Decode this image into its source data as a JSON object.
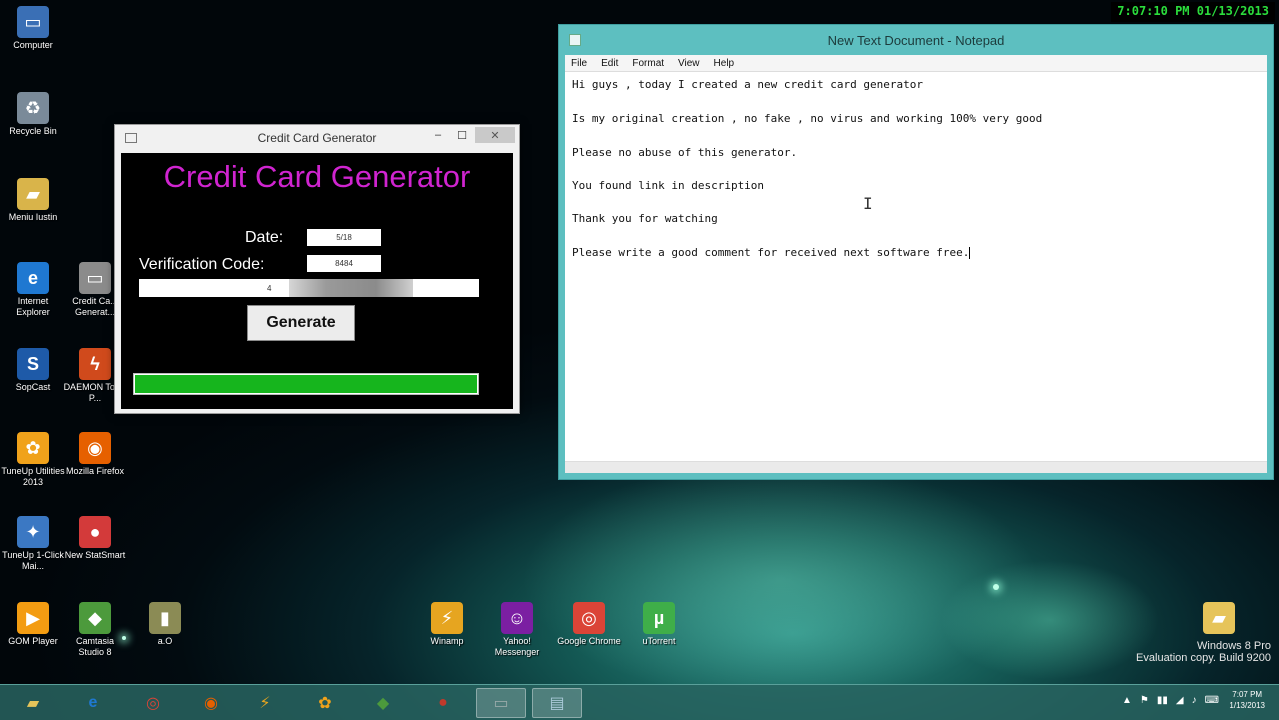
{
  "overlay_clock": "7:07:10 PM 01/13/2013",
  "desktop_icons": [
    {
      "label": "Computer",
      "icon": "computer-icon",
      "color": "#3a6fb5",
      "glyph": "▭"
    },
    {
      "label": "Recycle Bin",
      "icon": "recycle-bin-icon",
      "color": "#7a8a99",
      "glyph": "♻"
    },
    {
      "label": "Meniu Iustin",
      "icon": "folder-icon",
      "color": "#d9b44a",
      "glyph": "▰"
    },
    {
      "label": "Internet Explorer",
      "icon": "internet-explorer-icon",
      "color": "#1f78d1",
      "glyph": "e"
    },
    {
      "label": "Credit Ca... Generat...",
      "icon": "credit-card-generator-icon",
      "color": "#8b8b8b",
      "glyph": "▭"
    },
    {
      "label": "SopCast",
      "icon": "sopcast-icon",
      "color": "#1e5aa8",
      "glyph": "S"
    },
    {
      "label": "DAEMON Tools P...",
      "icon": "daemon-tools-icon",
      "color": "#d04a1c",
      "glyph": "ϟ"
    },
    {
      "label": "TuneUp Utilities 2013",
      "icon": "tuneup-utilities-icon",
      "color": "#f0a21b",
      "glyph": "✿"
    },
    {
      "label": "Mozilla Firefox",
      "icon": "firefox-icon",
      "color": "#e66000",
      "glyph": "◉"
    },
    {
      "label": "TuneUp 1-Click Mai...",
      "icon": "tuneup-1click-icon",
      "color": "#3b78c3",
      "glyph": "✦"
    },
    {
      "label": "New StatSmart",
      "icon": "statsmart-icon",
      "color": "#d33a3a",
      "glyph": "●"
    },
    {
      "label": "GOM Player",
      "icon": "gom-player-icon",
      "color": "#f39c12",
      "glyph": "▶"
    },
    {
      "label": "Camtasia Studio 8",
      "icon": "camtasia-icon",
      "color": "#4c9a3c",
      "glyph": "◆"
    },
    {
      "label": "a.O",
      "icon": "folder-icon",
      "color": "#8b8b55",
      "glyph": "▮"
    },
    {
      "label": "Winamp",
      "icon": "winamp-icon",
      "color": "#e6a520",
      "glyph": "⚡"
    },
    {
      "label": "Yahoo! Messenger",
      "icon": "yahoo-messenger-icon",
      "color": "#7b1fa2",
      "glyph": "☺"
    },
    {
      "label": "Google Chrome",
      "icon": "chrome-icon",
      "color": "#db4437",
      "glyph": "◎"
    },
    {
      "label": "uTorrent",
      "icon": "utorrent-icon",
      "color": "#3fae49",
      "glyph": "µ"
    },
    {
      "label": "",
      "icon": "folder-icon",
      "color": "#e6c45a",
      "glyph": "▰"
    }
  ],
  "ccg": {
    "title": "Credit Card Generator",
    "heading": "Credit Card Generator",
    "date_label": "Date:",
    "date_value": "5/18",
    "code_label": "Verification Code:",
    "code_value": "8484",
    "card_value": "4",
    "generate_label": "Generate",
    "progress": 1.0,
    "min_glyph": "–",
    "max_glyph": "☐",
    "close_glyph": "✕"
  },
  "notepad": {
    "title": "New Text Document - Notepad",
    "menu": [
      "File",
      "Edit",
      "Format",
      "View",
      "Help"
    ],
    "lines": [
      "Hi guys , today I created a new credit card generator",
      "Is my original creation , no fake , no virus and working 100% very good",
      "Please no abuse of this generator.",
      "You found link in description",
      "Thank you for watching",
      "Please write a good comment for received next software free."
    ],
    "close_glyph": "✕"
  },
  "taskbar": {
    "apps": [
      {
        "name": "file-explorer",
        "icon": "folder-icon",
        "color": "#e6c45a",
        "glyph": "▰"
      },
      {
        "name": "internet-explorer",
        "icon": "internet-explorer-icon",
        "color": "#1f78d1",
        "glyph": "e"
      },
      {
        "name": "chrome",
        "icon": "chrome-icon",
        "color": "#db4437",
        "glyph": "◎"
      },
      {
        "name": "firefox",
        "icon": "firefox-icon",
        "color": "#e66000",
        "glyph": "◉"
      },
      {
        "name": "winamp",
        "icon": "winamp-icon",
        "color": "#e6a520",
        "glyph": "⚡"
      },
      {
        "name": "tuneup",
        "icon": "tuneup-utilities-icon",
        "color": "#f0a21b",
        "glyph": "✿"
      },
      {
        "name": "camtasia",
        "icon": "camtasia-icon",
        "color": "#4c9a3c",
        "glyph": "◆"
      },
      {
        "name": "recorder",
        "icon": "recorder-icon",
        "color": "#c0392b",
        "glyph": "●"
      },
      {
        "name": "credit-card-generator",
        "icon": "credit-card-generator-icon",
        "color": "#9aa",
        "glyph": "▭"
      },
      {
        "name": "notepad",
        "icon": "notepad-icon",
        "color": "#a9c9d9",
        "glyph": "▤"
      }
    ],
    "tray": [
      "▲",
      "⚑",
      "▮▮",
      "◢",
      "♪",
      "⌨"
    ],
    "clock_time": "7:07 PM",
    "clock_date": "1/13/2013"
  },
  "watermark": {
    "line1": "Windows 8 Pro",
    "line2": "Evaluation copy. Build 9200"
  }
}
